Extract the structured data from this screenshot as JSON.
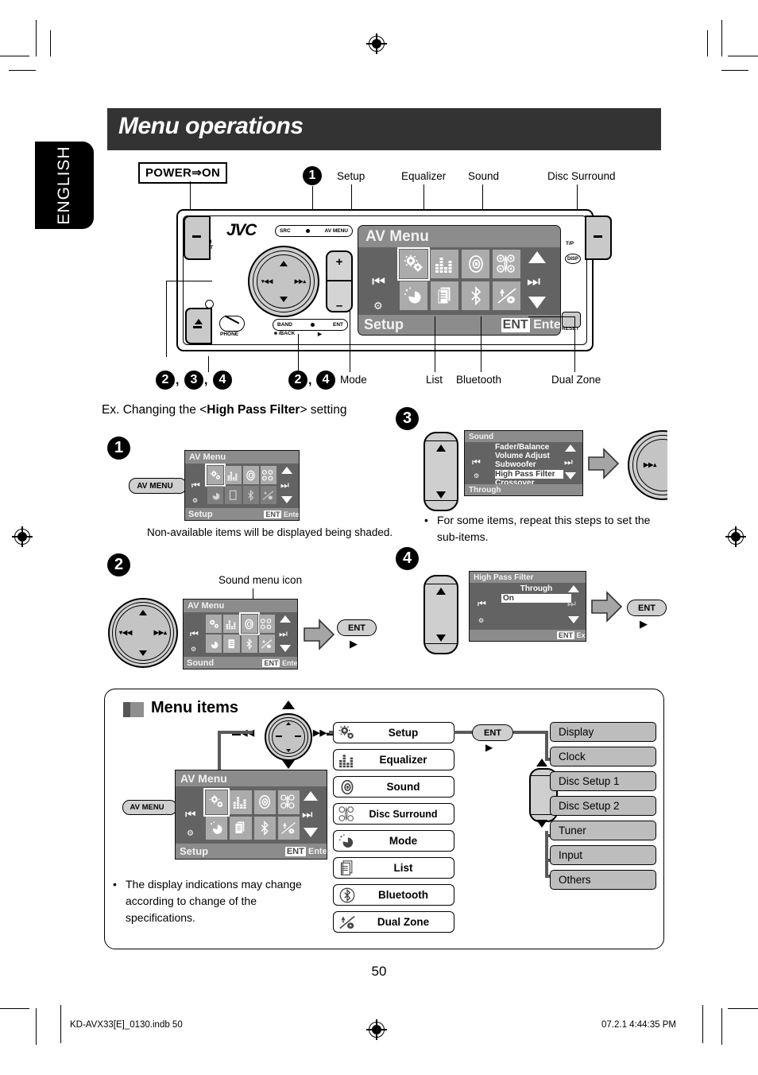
{
  "page": {
    "title": "Menu operations",
    "language_tab": "ENGLISH",
    "number": "50",
    "footer_left": "KD-AVX33[E]_0130.indb   50",
    "footer_right": "07.2.1   4:44:35 PM"
  },
  "unit": {
    "brand": "JVC",
    "power_label": "POWER⇒ON",
    "src_pill": {
      "left": "SRC",
      "right": "AV MENU"
    },
    "band_pill": {
      "left": "BAND",
      "right": "ENT"
    },
    "band_sub_left": "■ /BACK",
    "band_sub_right": "▶",
    "power_att": "⏻/I\nATT",
    "phone_label": "PHONE",
    "reset_label": "RESET",
    "tp_label": "T/P",
    "disp_label": "DISP",
    "plus": "+",
    "minus": "–"
  },
  "callouts": {
    "step_marker_top": "1",
    "top_labels": [
      "Setup",
      "Equalizer",
      "Sound",
      "Disc Surround"
    ],
    "bottom_left_group": [
      "2",
      "3",
      "4"
    ],
    "bottom_mid_group": [
      "2",
      "4"
    ],
    "bottom_labels": [
      "Mode",
      "List",
      "Bluetooth",
      "Dual Zone"
    ]
  },
  "example": {
    "heading_pre": "Ex. Changing the <",
    "heading_bold": "High Pass Filter",
    "heading_post": "> setting",
    "step1": {
      "number": "1",
      "button": "AV MENU",
      "note": "Non-available items will be displayed being shaded.",
      "screen": {
        "title": "AV Menu",
        "footer_left": "Setup",
        "footer_right_chip": "ENT",
        "footer_right": "Enter"
      }
    },
    "step2": {
      "number": "2",
      "pointer_label": "Sound menu icon",
      "button": "ENT",
      "play": "▶",
      "screen": {
        "title": "AV Menu",
        "footer_left": "Sound",
        "footer_right_chip": "ENT",
        "footer_right": "Enter"
      }
    },
    "step3": {
      "number": "3",
      "note": "For some items, repeat this steps to set the sub-items.",
      "screen": {
        "title": "Sound",
        "items": [
          "Fader/Balance",
          "Volume Adjust",
          "Subwoofer",
          "High Pass Filter",
          "Crossover"
        ],
        "selected": "High Pass Filter",
        "footer_left": "Through"
      }
    },
    "step4": {
      "number": "4",
      "button": "ENT",
      "play": "▶",
      "screen": {
        "title": "High Pass Filter",
        "items": [
          "Through",
          "On"
        ],
        "selected": "On",
        "footer_right_chip": "ENT",
        "footer_right": "Exit"
      }
    }
  },
  "menu_items": {
    "title": "Menu items",
    "av_menu_button": "AV MENU",
    "ent_button": "ENT",
    "play": "▶",
    "screen": {
      "title": "AV Menu",
      "footer_left": "Setup",
      "footer_right_chip": "ENT",
      "footer_right": "Enter"
    },
    "main_list": [
      {
        "label": "Setup",
        "icon": "gears-icon"
      },
      {
        "label": "Equalizer",
        "icon": "equalizer-bars-icon"
      },
      {
        "label": "Sound",
        "icon": "speaker-icon"
      },
      {
        "label": "Disc Surround",
        "icon": "surround-speakers-icon"
      },
      {
        "label": "Mode",
        "icon": "mode-dial-icon"
      },
      {
        "label": "List",
        "icon": "list-pages-icon"
      },
      {
        "label": "Bluetooth",
        "icon": "bluetooth-icon"
      },
      {
        "label": "Dual Zone",
        "icon": "dual-zone-icon"
      }
    ],
    "sub_list": [
      "Display",
      "Clock",
      "Disc Setup 1",
      "Disc Setup 2",
      "Tuner",
      "Input",
      "Others"
    ],
    "note": "The display indications may change according to change of the specifications."
  },
  "colors": {
    "header_bg": "#333333",
    "lcd_bg": "#636363",
    "lcd_bar": "#8c8c8c",
    "lcd_cell": "#ababab",
    "sub_button_bg": "#bdbdbd",
    "connector": "#5a5a5a"
  }
}
